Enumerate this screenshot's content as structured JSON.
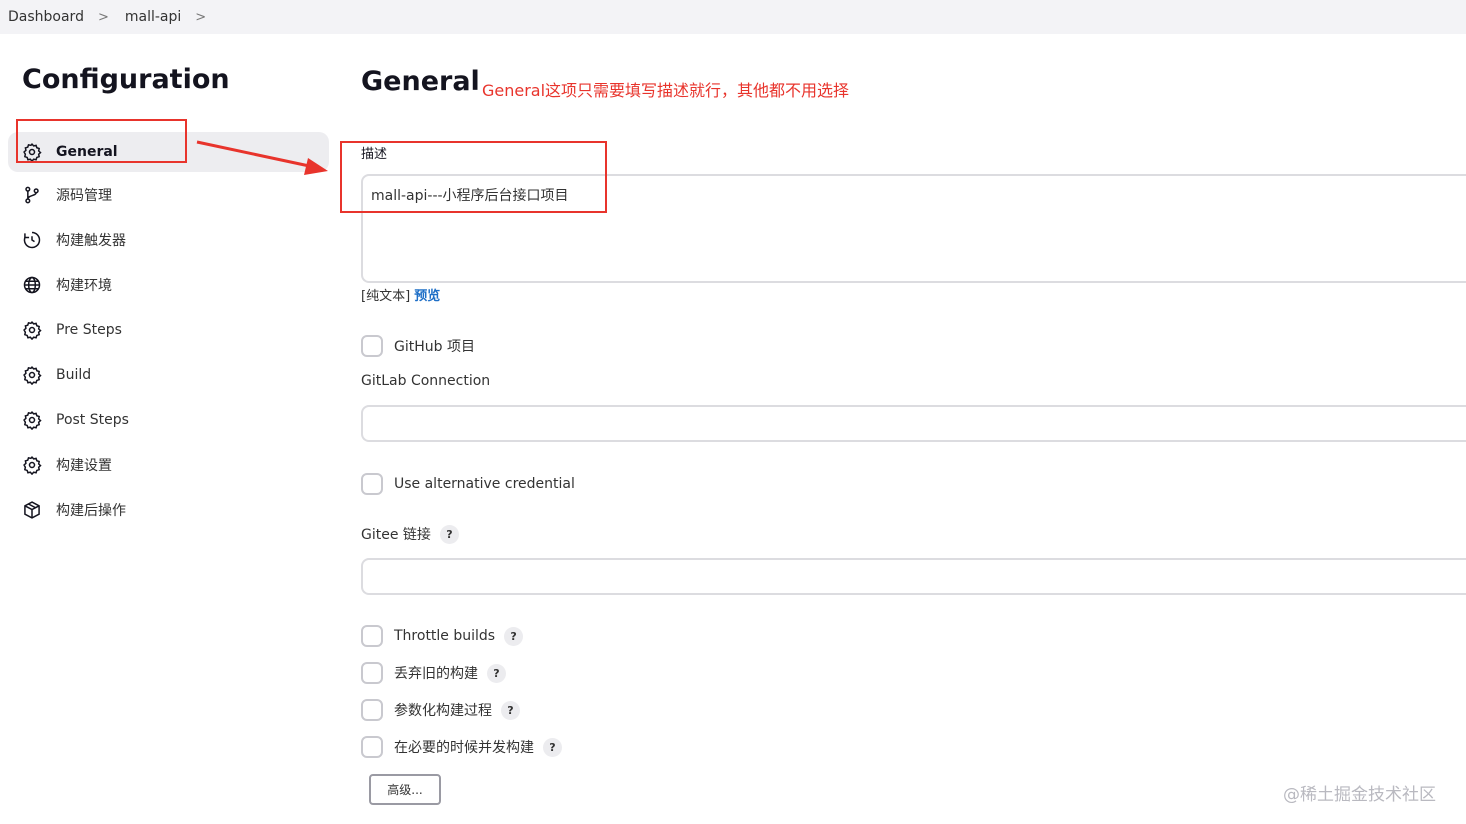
{
  "breadcrumb": {
    "items": [
      "Dashboard",
      "mall-api"
    ]
  },
  "sidebar": {
    "title": "Configuration",
    "items": [
      {
        "label": "General",
        "icon": "gear-icon",
        "active": true
      },
      {
        "label": "源码管理",
        "icon": "branch-icon"
      },
      {
        "label": "构建触发器",
        "icon": "clock-icon"
      },
      {
        "label": "构建环境",
        "icon": "globe-icon"
      },
      {
        "label": "Pre Steps",
        "icon": "gear-icon"
      },
      {
        "label": "Build",
        "icon": "gear-icon"
      },
      {
        "label": "Post Steps",
        "icon": "gear-icon"
      },
      {
        "label": "构建设置",
        "icon": "gear-icon"
      },
      {
        "label": "构建后操作",
        "icon": "package-icon"
      }
    ]
  },
  "main": {
    "title": "General",
    "annotation": "General这项只需要填写描述就行，其他都不用选择",
    "description": {
      "label": "描述",
      "value": "mall-api---小程序后台接口项目",
      "plain_text": "[纯文本]",
      "preview": "预览"
    },
    "github_project": "GitHub 项目",
    "gitlab_connection": "GitLab Connection",
    "use_alt_credential": "Use alternative credential",
    "gitee_link": "Gitee 链接",
    "throttle_builds": "Throttle builds",
    "discard_old_builds": "丢弃旧的构建",
    "parameterized": "参数化构建过程",
    "concurrent_builds": "在必要的时候并发构建",
    "help": "?",
    "advanced_button": "高级..."
  },
  "watermark": "@稀土掘金技术社区",
  "colors": {
    "annotation_red": "#e8342c",
    "link_blue": "#1e6fc7",
    "active_bg": "#ededf0"
  }
}
